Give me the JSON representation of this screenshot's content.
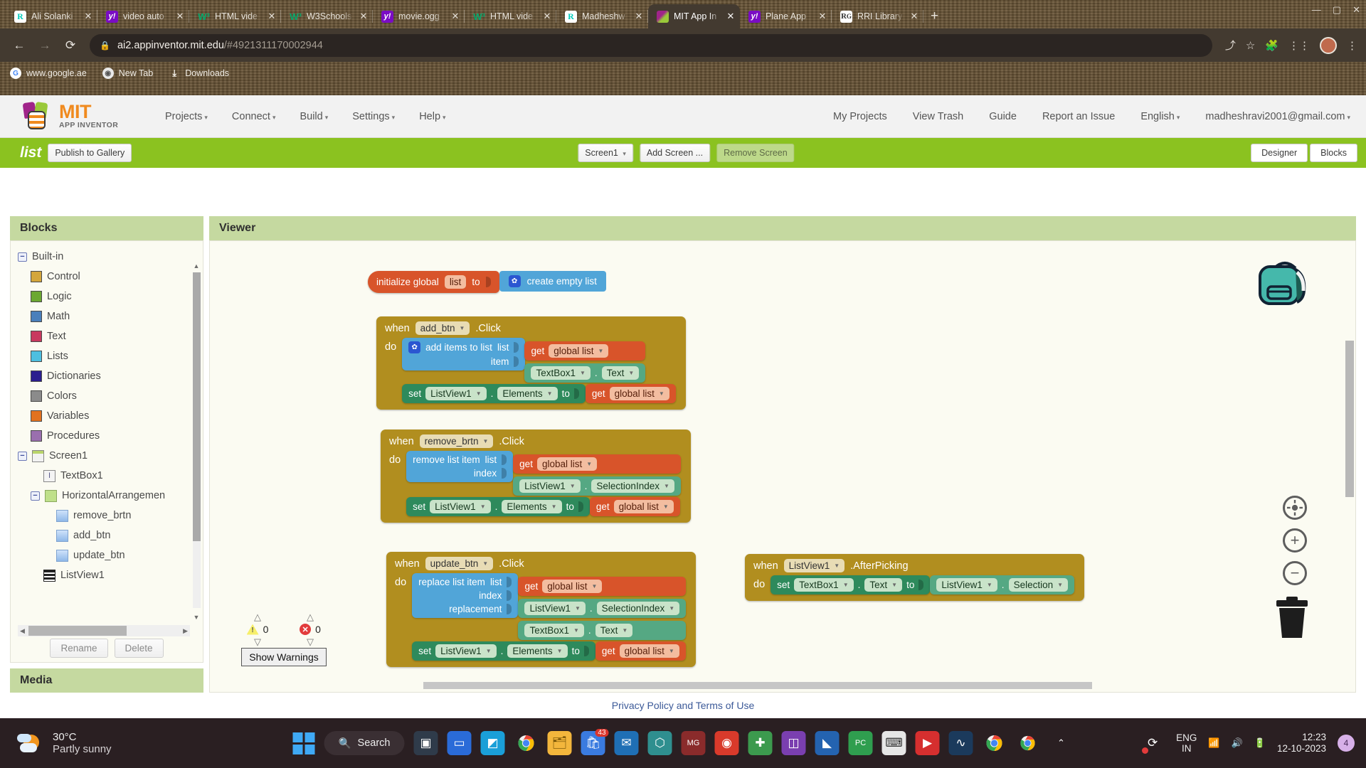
{
  "browser": {
    "tabs": [
      {
        "title": "Ali Solanki",
        "icon": "rg-icon",
        "active": false
      },
      {
        "title": "video auto",
        "icon": "yt-icon",
        "active": false
      },
      {
        "title": "HTML vide",
        "icon": "w3-icon",
        "active": false
      },
      {
        "title": "W3Schools",
        "icon": "w3-icon",
        "active": false
      },
      {
        "title": "movie.ogg",
        "icon": "yt-icon",
        "active": false
      },
      {
        "title": "HTML vide",
        "icon": "w3-icon",
        "active": false
      },
      {
        "title": "Madheshw",
        "icon": "rg-icon",
        "active": false
      },
      {
        "title": "MIT App In",
        "icon": "appinventor-icon",
        "active": true
      },
      {
        "title": "Plane App",
        "icon": "yt-icon",
        "active": false
      },
      {
        "title": "RRI Library",
        "icon": "rgw-icon",
        "active": false
      }
    ],
    "new_tab_label": "+",
    "close_label": "✕",
    "url_domain": "ai2.appinventor.mit.edu",
    "url_path": "/#4921311170002944",
    "bookmarks": [
      {
        "label": "www.google.ae",
        "icon": "google-icon"
      },
      {
        "label": "New Tab",
        "icon": "newtab-icon"
      },
      {
        "label": "Downloads",
        "icon": "download-icon"
      }
    ]
  },
  "ai_header": {
    "logo_main": "MIT",
    "logo_sub": "APP INVENTOR",
    "menus": [
      {
        "label": "Projects"
      },
      {
        "label": "Connect"
      },
      {
        "label": "Build"
      },
      {
        "label": "Settings"
      },
      {
        "label": "Help"
      }
    ],
    "links": [
      "My Projects",
      "View Trash",
      "Guide",
      "Report an Issue"
    ],
    "language": "English",
    "account": "madheshravi2001@gmail.com"
  },
  "project_bar": {
    "project_name": "list",
    "publish_label": "Publish to Gallery",
    "screen_select": "Screen1",
    "add_screen": "Add Screen ...",
    "remove_screen": "Remove Screen",
    "designer_label": "Designer",
    "blocks_label": "Blocks"
  },
  "palette": {
    "title": "Blocks",
    "media_title": "Media",
    "builtin_label": "Built-in",
    "builtin": [
      {
        "label": "Control",
        "color": "#d4a63c"
      },
      {
        "label": "Logic",
        "color": "#6ca832"
      },
      {
        "label": "Math",
        "color": "#4a7fbb"
      },
      {
        "label": "Text",
        "color": "#c8395f"
      },
      {
        "label": "Lists",
        "color": "#4ebfe0"
      },
      {
        "label": "Dictionaries",
        "color": "#2b1e8f"
      },
      {
        "label": "Colors",
        "color": "#8b8b8b"
      },
      {
        "label": "Variables",
        "color": "#e2721f"
      },
      {
        "label": "Procedures",
        "color": "#9a6fae"
      }
    ],
    "screen_label": "Screen1",
    "components": [
      {
        "label": "TextBox1",
        "icon": "textbox-icon",
        "indent": 2
      },
      {
        "label": "HorizontalArrangemen",
        "icon": "arrangement-icon",
        "indent": 1
      },
      {
        "label": "remove_brtn",
        "icon": "button-icon",
        "indent": 3
      },
      {
        "label": "add_btn",
        "icon": "button-icon",
        "indent": 3
      },
      {
        "label": "update_btn",
        "icon": "button-icon",
        "indent": 3
      },
      {
        "label": "ListView1",
        "icon": "listview-icon",
        "indent": 2
      }
    ],
    "rename_label": "Rename",
    "delete_label": "Delete"
  },
  "viewer": {
    "title": "Viewer"
  },
  "blocks": {
    "global_init": {
      "prefix": "initialize global",
      "name": "list",
      "to": "to",
      "value": "create empty list"
    },
    "add_event": {
      "when": "when",
      "component": "add_btn",
      "event": ".Click",
      "do": "do",
      "statement": "add items to list",
      "arg1_label": "list",
      "arg1_get": "get",
      "arg1_value": "global list",
      "arg2_label": "item",
      "arg2_obj": "TextBox1",
      "arg2_prop": "Text",
      "set_label": "set",
      "set_obj": "ListView1",
      "set_prop": "Elements",
      "set_to": "to",
      "set_get": "get",
      "set_value": "global list"
    },
    "remove_event": {
      "when": "when",
      "component": "remove_brtn",
      "event": ".Click",
      "do": "do",
      "statement": "remove list item",
      "arg1_label": "list",
      "arg1_get": "get",
      "arg1_value": "global list",
      "arg2_label": "index",
      "arg2_obj": "ListView1",
      "arg2_prop": "SelectionIndex",
      "set_label": "set",
      "set_obj": "ListView1",
      "set_prop": "Elements",
      "set_to": "to",
      "set_get": "get",
      "set_value": "global list"
    },
    "update_event": {
      "when": "when",
      "component": "update_btn",
      "event": ".Click",
      "do": "do",
      "statement": "replace list item",
      "arg1_label": "list",
      "arg1_get": "get",
      "arg1_value": "global list",
      "arg2_label": "index",
      "arg2_obj": "ListView1",
      "arg2_prop": "SelectionIndex",
      "arg3_label": "replacement",
      "arg3_obj": "TextBox1",
      "arg3_prop": "Text",
      "set_label": "set",
      "set_obj": "ListView1",
      "set_prop": "Elements",
      "set_to": "to",
      "set_get": "get",
      "set_value": "global list"
    },
    "afterpicking_event": {
      "when": "when",
      "component": "ListView1",
      "event": ".AfterPicking",
      "do": "do",
      "set_label": "set",
      "set_obj": "TextBox1",
      "set_prop": "Text",
      "set_to": "to",
      "val_obj": "ListView1",
      "val_prop": "Selection"
    }
  },
  "canvas": {
    "warning_count": "0",
    "error_count": "0",
    "show_warnings": "Show Warnings",
    "zoom_center_icon": "center-target-icon",
    "zoom_in_icon": "zoom-in-icon",
    "zoom_out_icon": "zoom-out-icon",
    "trash_icon": "trash-icon",
    "backpack_icon": "backpack-icon"
  },
  "footer": {
    "privacy_link": "Privacy Policy and Terms of Use"
  },
  "taskbar": {
    "temperature": "30°C",
    "condition": "Partly sunny",
    "search_label": "Search",
    "chat_badge": "43",
    "language_line1": "ENG",
    "language_line2": "IN",
    "time": "12:23",
    "date": "12-10-2023",
    "notification_count": "4"
  }
}
